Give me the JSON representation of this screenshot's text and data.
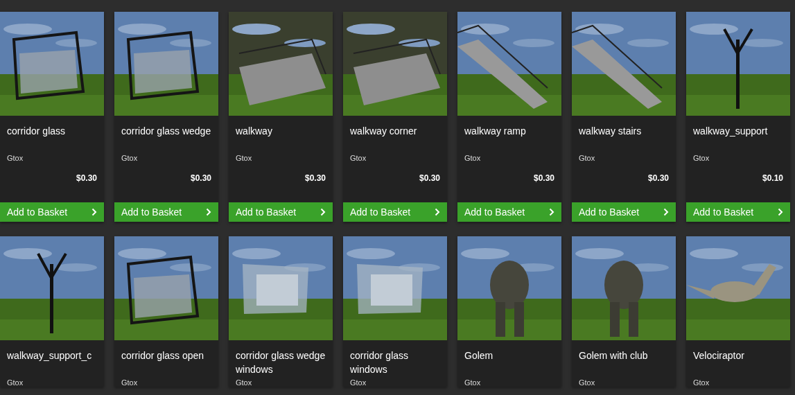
{
  "rows": [
    {
      "cards": [
        {
          "name": "corridor glass",
          "author": "Gtox",
          "price": "$0.30",
          "button": "Add to Basket"
        },
        {
          "name": "corridor glass wedge",
          "author": "Gtox",
          "price": "$0.30",
          "button": "Add to Basket"
        },
        {
          "name": "walkway",
          "author": "Gtox",
          "price": "$0.30",
          "button": "Add to Basket"
        },
        {
          "name": "walkway corner",
          "author": "Gtox",
          "price": "$0.30",
          "button": "Add to Basket"
        },
        {
          "name": "walkway ramp",
          "author": "Gtox",
          "price": "$0.30",
          "button": "Add to Basket"
        },
        {
          "name": "walkway stairs",
          "author": "Gtox",
          "price": "$0.30",
          "button": "Add to Basket"
        },
        {
          "name": "walkway_support",
          "author": "Gtox",
          "price": "$0.10",
          "button": "Add to Basket"
        }
      ]
    },
    {
      "cards": [
        {
          "name": "walkway_support_c",
          "author": "Gtox"
        },
        {
          "name": "corridor glass open",
          "author": "Gtox"
        },
        {
          "name": "corridor glass wedge windows",
          "author": "Gtox"
        },
        {
          "name": "corridor glass windows",
          "author": "Gtox"
        },
        {
          "name": "Golem",
          "author": "Gtox"
        },
        {
          "name": "Golem with club",
          "author": "Gtox"
        },
        {
          "name": "Velociraptor",
          "author": "Gtox"
        }
      ]
    }
  ]
}
